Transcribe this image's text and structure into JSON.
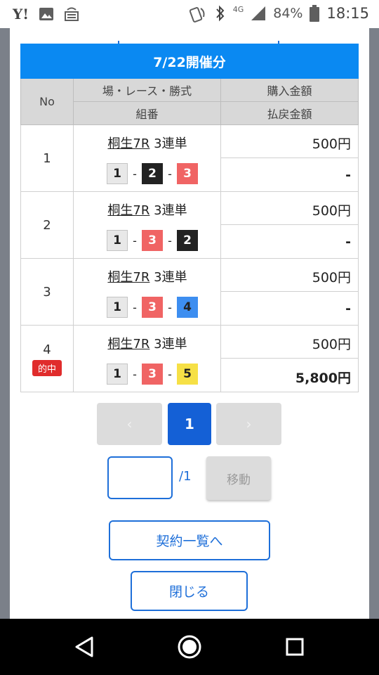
{
  "status_bar": {
    "carrier_icon": "Y!",
    "battery": "84%",
    "time": "18:15",
    "network": "4G"
  },
  "modal": {
    "title": "7/22開催分",
    "headers": {
      "no": "No",
      "race_type": "場・レース・勝式",
      "purchase": "購入金額",
      "combo": "組番",
      "payout": "払戻金額"
    },
    "rows": [
      {
        "no": "1",
        "race_link": "桐生7R",
        "bet_type": "3連単",
        "combo": [
          "1",
          "2",
          "3"
        ],
        "combo_colors": [
          "#e8e8e8",
          "#222222",
          "#f06464"
        ],
        "purchase": "500円",
        "payout": "-",
        "hit": ""
      },
      {
        "no": "2",
        "race_link": "桐生7R",
        "bet_type": "3連単",
        "combo": [
          "1",
          "3",
          "2"
        ],
        "combo_colors": [
          "#e8e8e8",
          "#f06464",
          "#222222"
        ],
        "purchase": "500円",
        "payout": "-",
        "hit": ""
      },
      {
        "no": "3",
        "race_link": "桐生7R",
        "bet_type": "3連単",
        "combo": [
          "1",
          "3",
          "4"
        ],
        "combo_colors": [
          "#e8e8e8",
          "#f06464",
          "#3d8ef0"
        ],
        "purchase": "500円",
        "payout": "-",
        "hit": ""
      },
      {
        "no": "4",
        "race_link": "桐生7R",
        "bet_type": "3連単",
        "combo": [
          "1",
          "3",
          "5"
        ],
        "combo_colors": [
          "#e8e8e8",
          "#f06464",
          "#f6e046"
        ],
        "purchase": "500円",
        "payout": "5,800円",
        "hit": "的中"
      }
    ],
    "pagination": {
      "prev": "‹",
      "current": "1",
      "next": "›",
      "input_value": "",
      "total": "/1",
      "move_label": "移動"
    },
    "contract_list_button": "契約一覧へ",
    "close_button": "閉じる"
  },
  "colors": {
    "title_bar": "#0a89f2",
    "accent": "#1e6fd9",
    "hit_badge": "#e02c2c"
  }
}
